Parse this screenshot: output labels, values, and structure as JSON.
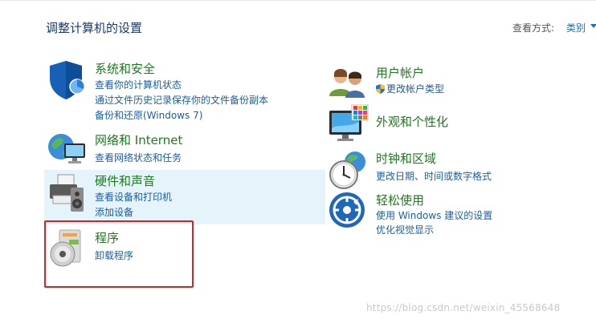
{
  "header": {
    "title": "调整计算机的设置",
    "view_by_label": "查看方式:",
    "view_by_value": "类别"
  },
  "left": {
    "security": {
      "title": "系统和安全",
      "links": [
        "查看你的计算机状态",
        "通过文件历史记录保存你的文件备份副本",
        "备份和还原(Windows 7)"
      ],
      "icon": "shield-icon"
    },
    "network": {
      "title": "网络和 Internet",
      "links": [
        "查看网络状态和任务"
      ],
      "icon": "globe-network-icon"
    },
    "hardware": {
      "title": "硬件和声音",
      "links": [
        "查看设备和打印机",
        "添加设备"
      ],
      "icon": "printer-speaker-icon"
    },
    "programs": {
      "title": "程序",
      "links": [
        "卸载程序"
      ],
      "icon": "programs-disc-icon"
    }
  },
  "right": {
    "accounts": {
      "title": "用户帐户",
      "links": [
        "更改帐户类型"
      ],
      "icon": "users-icon"
    },
    "appearance": {
      "title": "外观和个性化",
      "links": [],
      "icon": "monitor-palette-icon"
    },
    "clock": {
      "title": "时钟和区域",
      "links": [
        "更改日期、时间或数字格式"
      ],
      "icon": "clock-globe-icon"
    },
    "ease": {
      "title": "轻松使用",
      "links": [
        "使用 Windows 建议的设置",
        "优化视觉显示"
      ],
      "icon": "ease-of-access-icon"
    }
  },
  "watermark": "https://blog.csdn.net/weixin_45568648",
  "colors": {
    "title_green": "#1e7a1e",
    "link_blue": "#1b5ea9",
    "highlight_bg": "#e5f3fb",
    "annotation_red": "#e02020"
  }
}
